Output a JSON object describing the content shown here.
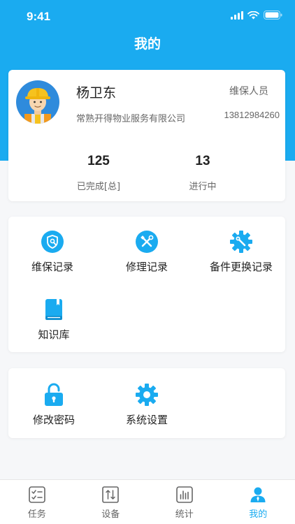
{
  "status_bar": {
    "time": "9:41"
  },
  "header": {
    "title": "我的"
  },
  "profile": {
    "name": "杨卫东",
    "role": "维保人员",
    "company": "常熟开得物业服务有限公司",
    "phone": "13812984260",
    "avatar_icon": "worker-avatar-icon",
    "stats": [
      {
        "value": "125",
        "label": "已完成[总]"
      },
      {
        "value": "13",
        "label": "进行中"
      }
    ]
  },
  "features": [
    {
      "label": "维保记录",
      "icon": "shield-wrench-icon"
    },
    {
      "label": "修理记录",
      "icon": "tools-icon"
    },
    {
      "label": "备件更换记录",
      "icon": "gear-wrench-icon"
    },
    {
      "label": "知识库",
      "icon": "book-icon"
    }
  ],
  "settings": [
    {
      "label": "修改密码",
      "icon": "lock-icon"
    },
    {
      "label": "系统设置",
      "icon": "gear-icon"
    }
  ],
  "tabbar": {
    "items": [
      {
        "label": "任务",
        "icon": "task-list-icon"
      },
      {
        "label": "设备",
        "icon": "device-icon"
      },
      {
        "label": "统计",
        "icon": "chart-icon"
      },
      {
        "label": "我的",
        "icon": "user-icon"
      }
    ],
    "active_index": 3
  },
  "colors": {
    "accent": "#1aabf0",
    "background": "#f6f7f9",
    "text": "#222222",
    "muted": "#666666"
  }
}
